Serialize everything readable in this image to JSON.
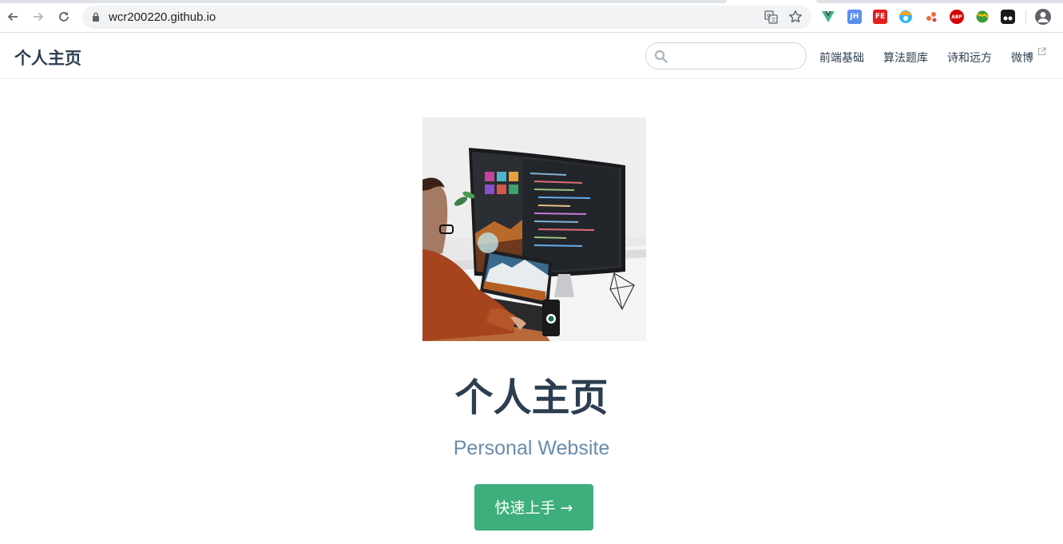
{
  "browser": {
    "url": "wcr200220.github.io",
    "extensions": [
      "vue-devtools-icon",
      "jh-icon",
      "fe-helper-icon",
      "globe-extension-icon",
      "people-extension-icon",
      "adblock-plus-icon",
      "earth-extension-icon",
      "tampermonkey-icon"
    ],
    "extension_labels": {
      "jh": "JH",
      "fe": "FE",
      "abp": "ABP"
    }
  },
  "navbar": {
    "site_name": "个人主页",
    "search": {
      "placeholder": "",
      "value": ""
    },
    "links": [
      {
        "label": "前端基础"
      },
      {
        "label": "算法题库"
      },
      {
        "label": "诗和远方"
      },
      {
        "label": "微博"
      }
    ]
  },
  "hero": {
    "title": "个人主页",
    "description": "Personal Website",
    "action_label": "快速上手 →"
  },
  "colors": {
    "accent": "#3eaf7c",
    "text": "#2c3e50",
    "description": "#6a8bad"
  }
}
